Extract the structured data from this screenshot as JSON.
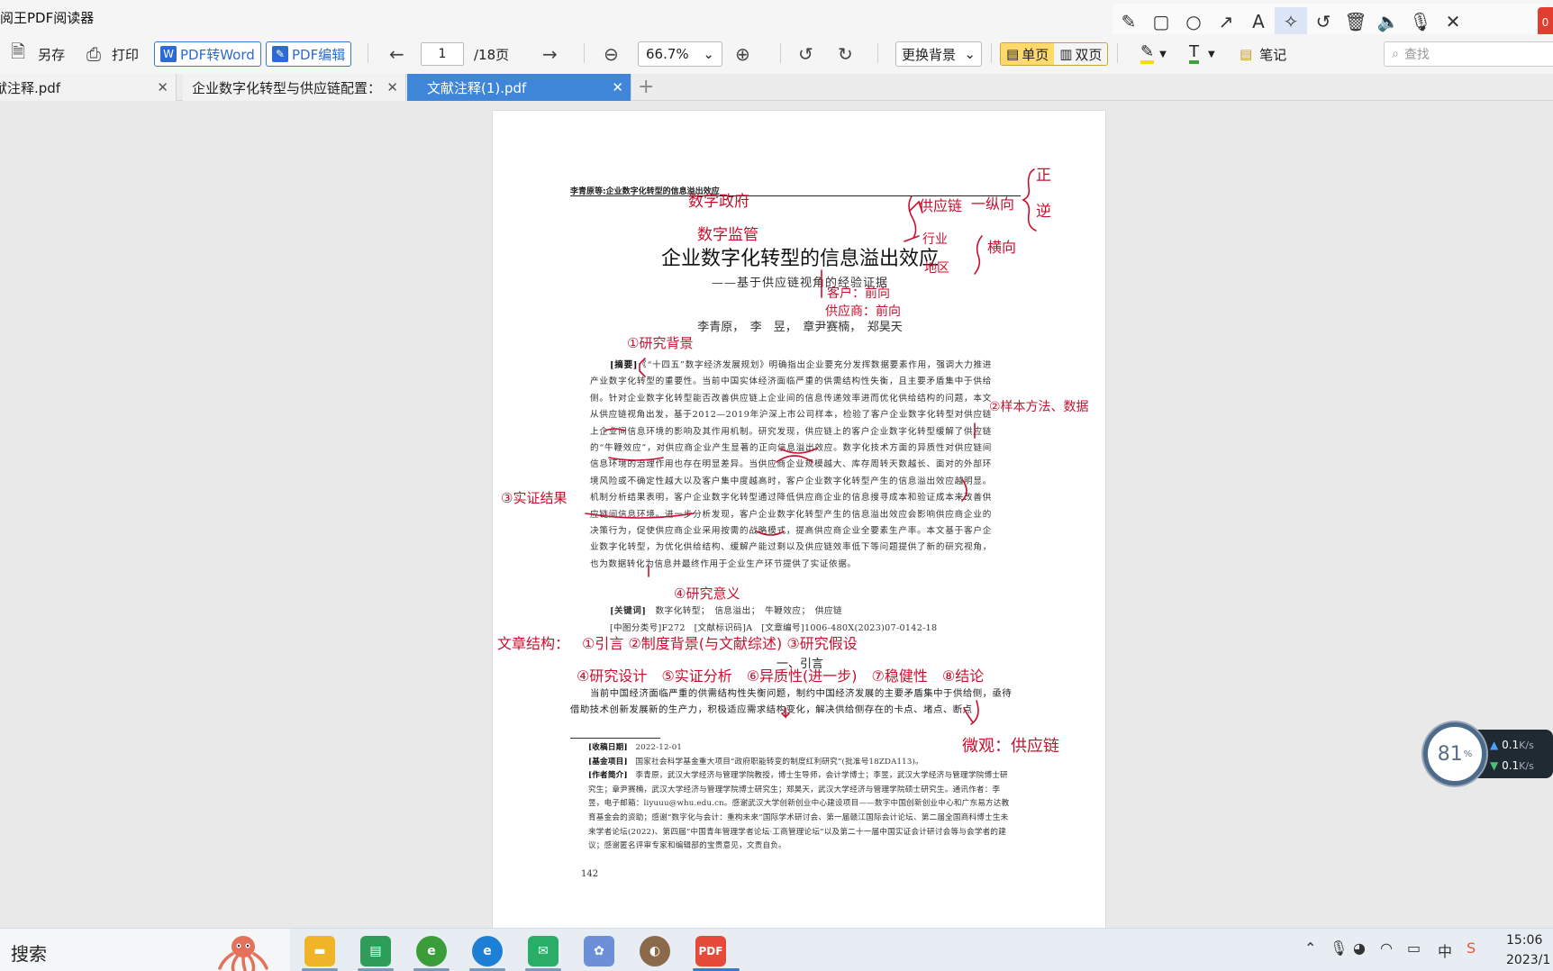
{
  "app": {
    "title": "阅王PDF阅读器"
  },
  "draw_tools": [
    "pencil-icon",
    "rectangle-icon",
    "circle-icon",
    "arrow-icon",
    "text-icon",
    "magic-wand-icon",
    "undo-icon",
    "delete-icon",
    "speaker-icon",
    "microphone-icon",
    "close-icon"
  ],
  "draw_badge": "0",
  "toolbar": {
    "save_as": "另存",
    "print": "打印",
    "to_word": "PDF转Word",
    "pdf_edit": "PDF编辑",
    "page_current": "1",
    "page_total": "/18页",
    "zoom": "66.7%",
    "background": "更换背景",
    "single_page": "单页",
    "double_page": "双页",
    "notes": "笔记",
    "search_placeholder": "查找"
  },
  "tabs": [
    {
      "label": "文献注释.pdf",
      "active": false
    },
    {
      "label": "企业数字化转型与供应链配置：",
      "active": false
    },
    {
      "label": "文献注释(1).pdf",
      "active": true
    }
  ],
  "document": {
    "running_head": "李青原等:企业数字化转型的信息溢出效应",
    "title": "企业数字化转型的信息溢出效应",
    "subtitle": "——基于供应链视角的经验证据",
    "authors": "李青原，　李　昱，　章尹赛楠，　郑昊天",
    "abstract_label": "[摘要]",
    "abstract_text": "《“十四五”数字经济发展规划》明确指出企业要充分发挥数据要素作用，强调大力推进产业数字化转型的重要性。当前中国实体经济面临严重的供需结构性失衡，且主要矛盾集中于供给侧。针对企业数字化转型能否改善供应链上企业间的信息传递效率进而优化供给结构的问题，本文从供应链视角出发，基于2012—2019年沪深上市公司样本，检验了客户企业数字化转型对供应链上企业间信息环境的影响及其作用机制。研究发现，供应链上的客户企业数字化转型缓解了供应链的“牛鞭效应”，对供应商企业产生显著的正向信息溢出效应。数字化技术方面的异质性对供应链间信息环境的治理作用也存在明显差异。当供应商企业规模越大、库存周转天数越长、面对的外部环境风险或不确定性越大以及客户集中度越高时，客户企业数字化转型产生的信息溢出效应越明显。机制分析结果表明，客户企业数字化转型通过降低供应商企业的信息搜寻成本和验证成本来改善供应链间信息环境。进一步分析发现，客户企业数字化转型产生的信息溢出效应会影响供应商企业的决策行为，促使供应商企业采用按需的战略模式，提高供应商企业全要素生产率。本文基于客户企业数字化转型，为优化供给结构、缓解产能过剩以及供应链效率低下等问题提供了新的研究视角，也为数据转化为信息并最终作用于企业生产环节提供了实证依据。",
    "keywords_label": "[关键词]",
    "keywords": "数字化转型；　信息溢出；　牛鞭效应；　供应链",
    "class_line": "[中图分类号]F272　[文献标识码]A　[文章编号]1006-480X(2023)07-0142-18",
    "section_heading": "一、引言",
    "intro_text": "当前中国经济面临严重的供需结构性失衡问题，制约中国经济发展的主要矛盾集中于供给侧，亟待借助技术创新发展新的生产力，积极适应需求结构变化，解决供给侧存在的卡点、堵点、断点",
    "footnotes": [
      {
        "label": "[收稿日期]",
        "text": "2022-12-01"
      },
      {
        "label": "[基金项目]",
        "text": "国家社会科学基金重大项目“政府职能转变的制度红利研究”(批准号18ZDA113)。"
      },
      {
        "label": "[作者简介]",
        "text": "李青原，武汉大学经济与管理学院教授，博士生导师，会计学博士；李昱，武汉大学经济与管理学院博士研究生；章尹赛楠，武汉大学经济与管理学院博士研究生；郑昊天，武汉大学经济与管理学院硕士研究生。通讯作者：李昱，电子邮箱：liyuuu@whu.edu.cn。感谢武汉大学创新创业中心建设项目——数字中国创新创业中心和广东易方达教育基金会的资助；感谢“数字化与会计：重构未来”国际学术研讨会、第一届赣江国际会计论坛、第二届全国商科博士生未来学者论坛(2022)、第四届“中国青年管理学者论坛·工商管理论坛”以及第二十一届中国实证会计研讨会等与会学者的建议；感谢匿名评审专家和编辑部的宝贵意见，文责自负。"
      }
    ],
    "page_number": "142"
  },
  "annotations": {
    "a1": "数字政府",
    "a2": "数字监管",
    "a3": "供应链",
    "a4": "一纵向",
    "a5": "正",
    "a6": "逆",
    "a7": "行业",
    "a8": "地区",
    "a9": "横向",
    "a10": "客户：前向",
    "a11": "供应商：前向",
    "a12": "①研究背景",
    "a13": "②样本方法、数据",
    "a14": "③实证结果",
    "a15": "④研究意义",
    "a16": "文章结构：",
    "a17": "①引言 ②制度背景(与文献综述) ③研究假设",
    "a18": "④研究设计　⑤实证分析　⑥异质性(进一步)　⑦稳健性　⑧结论",
    "a19": "微观：供应链"
  },
  "speed_widget": {
    "percent": "81",
    "unit": "%",
    "up": "0.1",
    "down": "0.1",
    "rate_unit": "K/s"
  },
  "taskbar": {
    "search": "搜索",
    "apps": [
      "file-explorer",
      "notes",
      "ie-browser",
      "edge-browser",
      "wechat",
      "app-store",
      "photo",
      "pdf-reader"
    ],
    "pdf_label": "PDF",
    "ime": "中",
    "time": "15:06",
    "date": "2023/1"
  }
}
